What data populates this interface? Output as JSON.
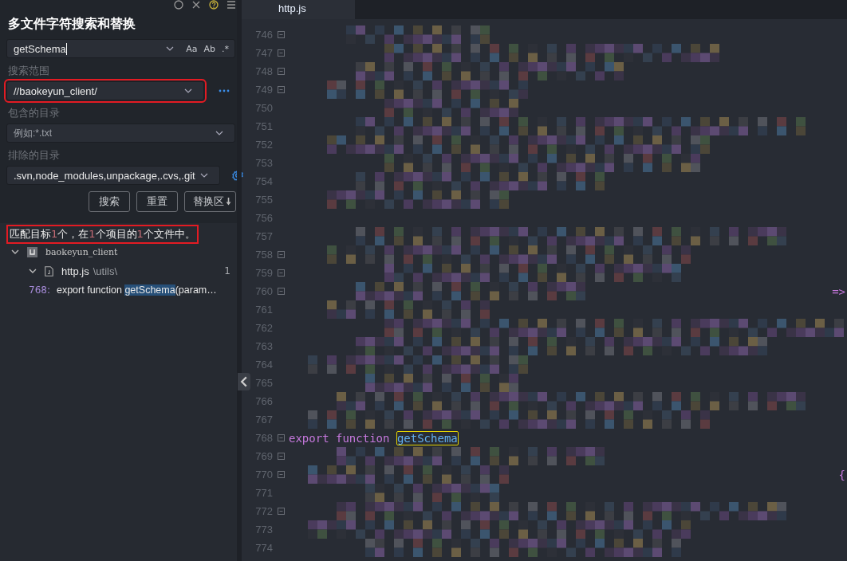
{
  "panel": {
    "title": "多文件字符搜索和替换",
    "search": {
      "value": "getSchema",
      "toggles": [
        {
          "label": "Aa",
          "selected": false
        },
        {
          "label": "Ab",
          "selected": false
        },
        {
          "label": ".*",
          "selected": false
        }
      ]
    },
    "scope": {
      "label": "搜索范围",
      "value": "//baokeyun_client/",
      "annotated": true
    },
    "include": {
      "label": "包含的目录",
      "placeholder": "例如:*.txt"
    },
    "exclude": {
      "label": "排除的目录",
      "value": ".svn,node_modules,unpackage,.cvs,.git"
    },
    "buttons": [
      {
        "label": "搜索",
        "kind": "plain"
      },
      {
        "label": "重置",
        "kind": "plain"
      },
      {
        "label": "替换区",
        "kind": "toggle"
      }
    ],
    "summary": {
      "annotated": true,
      "parts": [
        {
          "text": "匹配目标",
          "kind": "plain"
        },
        {
          "text": "1",
          "kind": "count"
        },
        {
          "text": "个，在",
          "kind": "plain"
        },
        {
          "text": "1",
          "kind": "count"
        },
        {
          "text": "个项目的",
          "kind": "plain"
        },
        {
          "text": "1",
          "kind": "count"
        },
        {
          "text": "个文件中。",
          "kind": "plain"
        }
      ]
    },
    "results": [
      {
        "kind": "project",
        "label": "baokeyun_client",
        "expanded": true,
        "children": [
          {
            "kind": "file",
            "label": "http.js",
            "path": "\\utils\\",
            "count": "1",
            "expanded": true,
            "children": [
              {
                "kind": "match",
                "line": "768:",
                "before": "export function ",
                "match": "getSchema",
                "after": "(param…"
              }
            ]
          }
        ]
      }
    ]
  },
  "editor": {
    "tabs": [
      {
        "label": "http.js",
        "selected": true
      }
    ],
    "lines": [
      {
        "number": "746",
        "fold": true,
        "kind": "pixelated"
      },
      {
        "number": "747",
        "fold": true,
        "kind": "pixelated"
      },
      {
        "number": "748",
        "fold": true,
        "kind": "pixelated"
      },
      {
        "number": "749",
        "fold": true,
        "kind": "pixelated"
      },
      {
        "number": "750",
        "fold": false,
        "kind": "pixelated"
      },
      {
        "number": "751",
        "fold": false,
        "kind": "pixelated"
      },
      {
        "number": "752",
        "fold": false,
        "kind": "pixelated"
      },
      {
        "number": "753",
        "fold": false,
        "kind": "pixelated"
      },
      {
        "number": "754",
        "fold": false,
        "kind": "pixelated"
      },
      {
        "number": "755",
        "fold": false,
        "kind": "pixelated"
      },
      {
        "number": "756",
        "fold": false,
        "kind": "blank"
      },
      {
        "number": "757",
        "fold": false,
        "kind": "pixelated"
      },
      {
        "number": "758",
        "fold": true,
        "kind": "pixelated"
      },
      {
        "number": "759",
        "fold": true,
        "kind": "pixelated"
      },
      {
        "number": "760",
        "fold": true,
        "kind": "pixelated",
        "tail": "=>"
      },
      {
        "number": "761",
        "fold": false,
        "kind": "pixelated"
      },
      {
        "number": "762",
        "fold": false,
        "kind": "pixelated"
      },
      {
        "number": "763",
        "fold": false,
        "kind": "pixelated"
      },
      {
        "number": "764",
        "fold": false,
        "kind": "pixelated"
      },
      {
        "number": "765",
        "fold": false,
        "kind": "pixelated"
      },
      {
        "number": "766",
        "fold": false,
        "kind": "pixelated"
      },
      {
        "number": "767",
        "fold": false,
        "kind": "pixelated"
      },
      {
        "number": "768",
        "fold": true,
        "kind": "code",
        "tokens": [
          {
            "text": "export",
            "kind": "keyword"
          },
          {
            "text": "function",
            "kind": "keyword"
          },
          {
            "text": "getSchema",
            "kind": "match"
          }
        ]
      },
      {
        "number": "769",
        "fold": true,
        "kind": "pixelated"
      },
      {
        "number": "770",
        "fold": true,
        "kind": "pixelated",
        "tail": "{"
      },
      {
        "number": "771",
        "fold": false,
        "kind": "pixelated"
      },
      {
        "number": "772",
        "fold": true,
        "kind": "pixelated"
      },
      {
        "number": "773",
        "fold": false,
        "kind": "pixelated"
      },
      {
        "number": "774",
        "fold": false,
        "kind": "pixelated"
      }
    ]
  }
}
